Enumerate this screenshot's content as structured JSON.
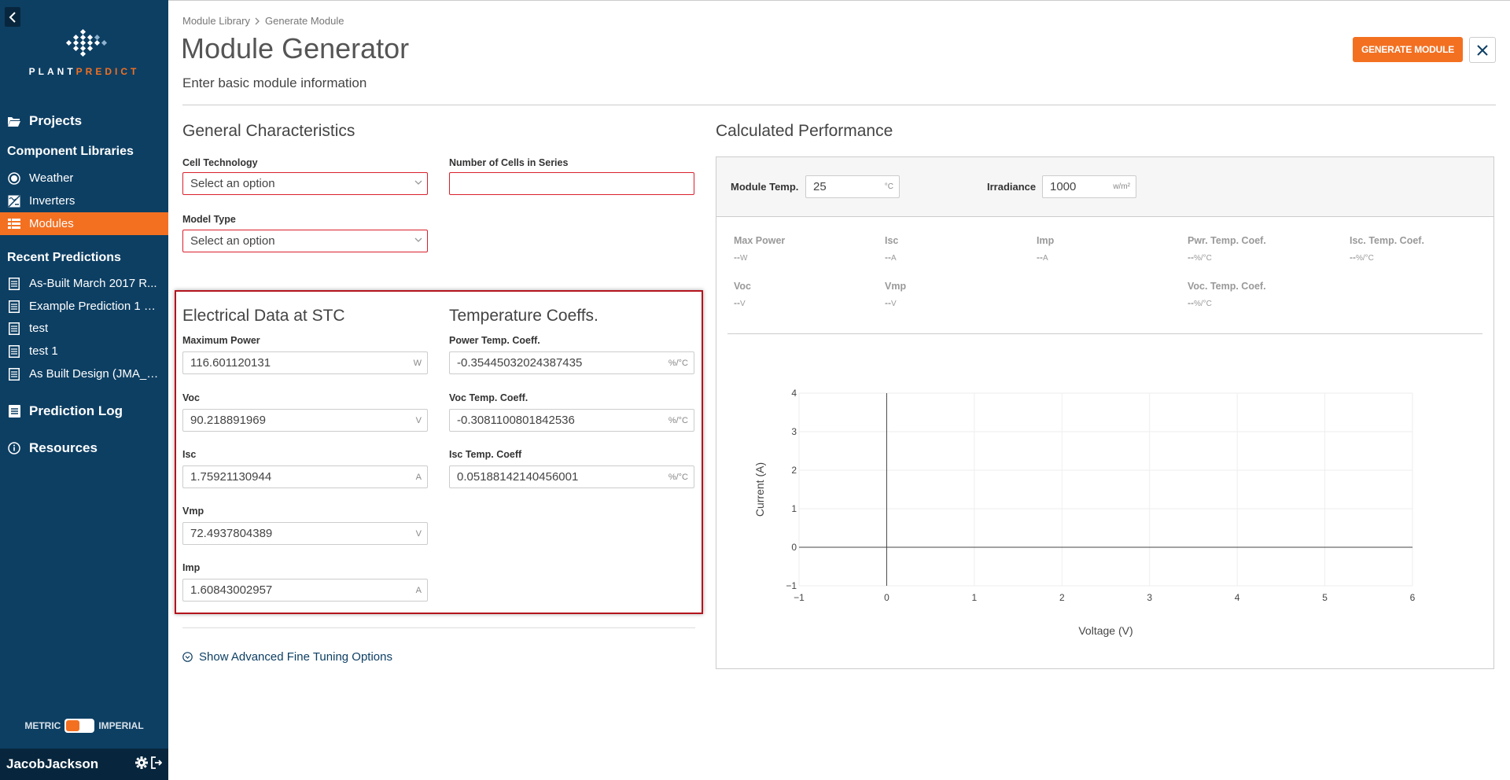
{
  "sidebar": {
    "logo": {
      "text_a": "PLANT",
      "text_b": "PREDICT"
    },
    "projects_label": "Projects",
    "component_libraries_header": "Component Libraries",
    "libraries": [
      {
        "label": "Weather",
        "icon": "weather-icon"
      },
      {
        "label": "Inverters",
        "icon": "inverter-icon"
      },
      {
        "label": "Modules",
        "icon": "modules-icon",
        "active": true
      }
    ],
    "recent_predictions_header": "Recent Predictions",
    "recent_predictions": [
      {
        "label": "As-Built March 2017 R..."
      },
      {
        "label": "Example Prediction 1 - ..."
      },
      {
        "label": "test"
      },
      {
        "label": "test 1"
      },
      {
        "label": "As Built Design (JMA_I..."
      }
    ],
    "prediction_log_label": "Prediction Log",
    "resources_label": "Resources",
    "units": {
      "metric": "METRIC",
      "imperial": "IMPERIAL",
      "selected": "metric"
    },
    "username": "JacobJackson"
  },
  "header": {
    "breadcrumb": [
      "Module Library",
      "Generate Module"
    ],
    "title": "Module Generator",
    "subtitle": "Enter basic module information",
    "generate_button": "GENERATE MODULE"
  },
  "general": {
    "title": "General Characteristics",
    "cell_technology": {
      "label": "Cell Technology",
      "value": "Select an option"
    },
    "cells_in_series": {
      "label": "Number of Cells in Series",
      "value": ""
    },
    "model_type": {
      "label": "Model Type",
      "value": "Select an option"
    }
  },
  "electrical": {
    "title": "Electrical Data at STC",
    "fields": [
      {
        "label": "Maximum Power",
        "value": "116.601120131",
        "unit": "W"
      },
      {
        "label": "Voc",
        "value": "90.218891969",
        "unit": "V"
      },
      {
        "label": "Isc",
        "value": "1.75921130944",
        "unit": "A"
      },
      {
        "label": "Vmp",
        "value": "72.4937804389",
        "unit": "V"
      },
      {
        "label": "Imp",
        "value": "1.60843002957",
        "unit": "A"
      }
    ]
  },
  "temperature": {
    "title": "Temperature Coeffs.",
    "fields": [
      {
        "label": "Power Temp. Coeff.",
        "value": "-0.35445032024387435",
        "unit": "%/°C"
      },
      {
        "label": "Voc Temp. Coeff.",
        "value": "-0.3081100801842536",
        "unit": "%/°C"
      },
      {
        "label": "Isc Temp. Coeff",
        "value": "0.05188142140456001",
        "unit": "%/°C"
      }
    ]
  },
  "advanced_link": "Show Advanced Fine Tuning Options",
  "performance": {
    "title": "Calculated Performance",
    "module_temp": {
      "label": "Module Temp.",
      "value": "25",
      "unit": "°C"
    },
    "irradiance": {
      "label": "Irradiance",
      "value": "1000",
      "unit": "w/m²"
    },
    "results": [
      {
        "label": "Max Power",
        "value": "--",
        "unit": "W"
      },
      {
        "label": "Isc",
        "value": "--",
        "unit": "A"
      },
      {
        "label": "Imp",
        "value": "--",
        "unit": "A"
      },
      {
        "label": "Pwr. Temp. Coef.",
        "value": "--",
        "unit": "%/°C"
      },
      {
        "label": "Isc. Temp. Coef.",
        "value": "--",
        "unit": "%/°C"
      },
      {
        "label": "Voc",
        "value": "--",
        "unit": "V"
      },
      {
        "label": "Vmp",
        "value": "--",
        "unit": "V"
      },
      {
        "label": "Voc. Temp. Coef.",
        "value": "--",
        "unit": "%/°C"
      }
    ]
  },
  "chart_data": {
    "type": "line",
    "title": "",
    "xlabel": "Voltage (V)",
    "ylabel": "Current (A)",
    "xlim": [
      -1,
      6
    ],
    "ylim": [
      -1,
      4
    ],
    "x_ticks": [
      "−1",
      "0",
      "1",
      "2",
      "3",
      "4",
      "5",
      "6"
    ],
    "y_ticks": [
      "−1",
      "0",
      "1",
      "2",
      "3",
      "4"
    ],
    "grid": true,
    "series": []
  },
  "colors": {
    "sidebar": "#0d3f63",
    "accent": "#f37021",
    "error": "#d9202b"
  }
}
